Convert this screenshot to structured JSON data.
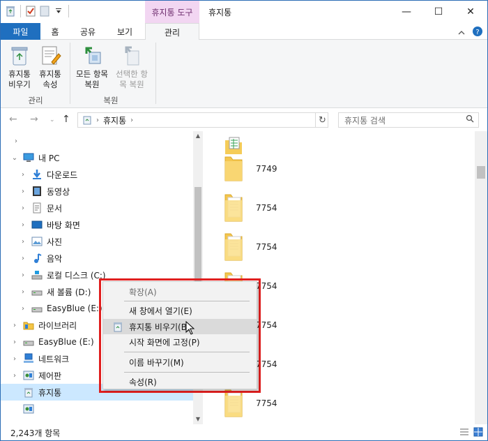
{
  "title_bar": {
    "context_tab_title": "휴지통 도구",
    "window_title": "휴지통",
    "minimize_glyph": "—",
    "maximize_glyph": "☐",
    "close_glyph": "✕"
  },
  "ribbon_tabs": {
    "file": "파일",
    "home": "홈",
    "share": "공유",
    "view": "보기",
    "manage": "관리"
  },
  "ribbon": {
    "empty_recycle_bin": "휴지통 비우기",
    "properties": "휴지통 속성",
    "restore_all": "모든 항목 복원",
    "restore_selected": "선택한 항목 복원",
    "group_manage": "관리",
    "group_restore": "복원"
  },
  "address_bar": {
    "path": "휴지통",
    "search_placeholder": "휴지통 검색"
  },
  "tree": {
    "items": [
      {
        "label": "내 PC",
        "icon": "computer-icon",
        "chevron": "⌄"
      },
      {
        "label": "다운로드",
        "icon": "download-icon",
        "chevron": "›"
      },
      {
        "label": "동영상",
        "icon": "video-icon",
        "chevron": "›"
      },
      {
        "label": "문서",
        "icon": "document-icon",
        "chevron": "›"
      },
      {
        "label": "바탕 화면",
        "icon": "desktop-icon",
        "chevron": "›"
      },
      {
        "label": "사진",
        "icon": "pictures-icon",
        "chevron": "›"
      },
      {
        "label": "음악",
        "icon": "music-icon",
        "chevron": "›"
      },
      {
        "label": "로컬 디스크 (C:)",
        "icon": "local-disk-icon",
        "chevron": "›"
      },
      {
        "label": "새 볼륨 (D:)",
        "icon": "drive-icon",
        "chevron": "›"
      },
      {
        "label": "EasyBlue (E:)",
        "icon": "drive-icon",
        "chevron": "›"
      },
      {
        "label": "라이브러리",
        "icon": "library-icon",
        "chevron": "›"
      },
      {
        "label": "EasyBlue (E:)",
        "icon": "drive-icon",
        "chevron": "›"
      },
      {
        "label": "네트워크",
        "icon": "network-icon",
        "chevron": "›"
      },
      {
        "label": "제어판",
        "icon": "control-panel-icon",
        "chevron": "›"
      },
      {
        "label": "휴지통",
        "icon": "recycle-bin-icon",
        "chevron": ""
      }
    ]
  },
  "files": {
    "items": [
      {
        "name": "",
        "icon": "spreadsheet-icon"
      },
      {
        "name": "7749",
        "icon": "folder-icon"
      },
      {
        "name": "7754",
        "icon": "zip-folder-icon"
      },
      {
        "name": "7754",
        "icon": "zip-folder-icon"
      },
      {
        "name": "7754",
        "icon": "zip-folder-icon"
      },
      {
        "name": "7754",
        "icon": "zip-folder-icon"
      },
      {
        "name": "7754",
        "icon": "zip-folder-icon"
      },
      {
        "name": "7754",
        "icon": "zip-folder-icon"
      }
    ]
  },
  "context_menu": {
    "expand": "확장(A)",
    "open_new_window": "새 창에서 열기(E)",
    "empty_recycle_bin": "휴지통 비우기(B)",
    "pin_to_start": "시작 화면에 고정(P)",
    "rename": "이름 바꾸기(M)",
    "properties": "속성(R)"
  },
  "status_bar": {
    "item_count": "2,243개 항목"
  },
  "colors": {
    "file_tab": "#1f6fbf",
    "context_tab": "#f2d6f2",
    "selection": "#cce8ff",
    "highlight_box": "#e01f1f"
  }
}
